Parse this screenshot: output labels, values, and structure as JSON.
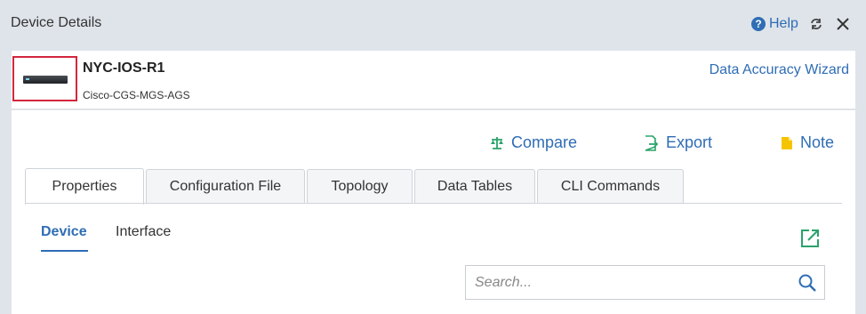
{
  "window": {
    "title": "Device Details",
    "help_label": "Help",
    "help_icon": "question-circle-icon",
    "refresh_icon": "refresh-icon",
    "close_icon": "close-icon"
  },
  "device": {
    "name": "NYC-IOS-R1",
    "model": "Cisco-CGS-MGS-AGS",
    "image_icon": "router-device-icon",
    "data_accuracy_wizard": "Data Accuracy Wizard"
  },
  "actions": {
    "compare": {
      "label": "Compare",
      "icon": "scale-icon",
      "color": "#2aa36b"
    },
    "export": {
      "label": "Export",
      "icon": "export-icon",
      "color": "#2aa36b"
    },
    "note": {
      "label": "Note",
      "icon": "note-icon",
      "color": "#f5c400"
    }
  },
  "tabs": [
    {
      "label": "Properties",
      "active": true
    },
    {
      "label": "Configuration File",
      "active": false
    },
    {
      "label": "Topology",
      "active": false
    },
    {
      "label": "Data Tables",
      "active": false
    },
    {
      "label": "CLI Commands",
      "active": false
    }
  ],
  "subtabs": [
    {
      "label": "Device",
      "active": true
    },
    {
      "label": "Interface",
      "active": false
    }
  ],
  "popout_icon": "open-in-new-window-icon",
  "search": {
    "placeholder": "Search...",
    "value": "",
    "icon": "search-icon"
  },
  "colors": {
    "accent": "#2f6db5",
    "highlight_frame": "#d4263e",
    "green": "#2aa36b"
  }
}
